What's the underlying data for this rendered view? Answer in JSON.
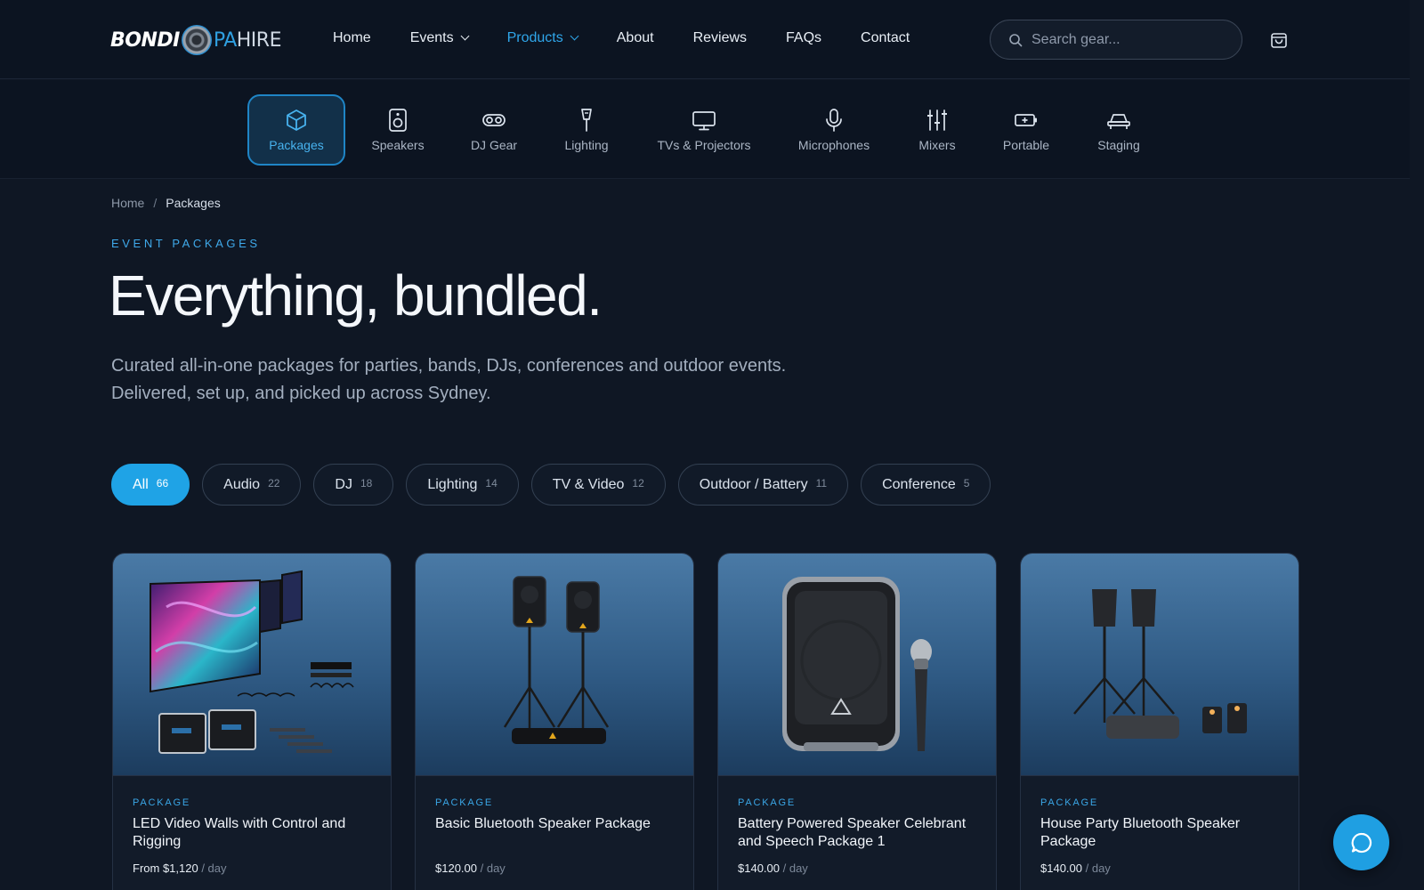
{
  "brand": {
    "name_bold": "BONDI",
    "name_light_a": "PA",
    "name_light_b": "HIRE"
  },
  "nav": {
    "items": [
      {
        "label": "Home",
        "dropdown": false,
        "active": false,
        "icon": ""
      },
      {
        "label": "Events",
        "dropdown": true,
        "active": false,
        "icon": "chevron-down-icon"
      },
      {
        "label": "Products",
        "dropdown": true,
        "active": true,
        "icon": "chevron-down-icon"
      },
      {
        "label": "About",
        "dropdown": false,
        "active": false,
        "icon": ""
      },
      {
        "label": "Reviews",
        "dropdown": false,
        "active": false,
        "icon": ""
      },
      {
        "label": "FAQs",
        "dropdown": false,
        "active": false,
        "icon": ""
      },
      {
        "label": "Contact",
        "dropdown": false,
        "active": false,
        "icon": ""
      }
    ],
    "active_color": "#2fa6ea"
  },
  "search": {
    "placeholder": "Search gear...",
    "value": "",
    "icon": "search-icon"
  },
  "cart": {
    "icon": "shopping-bag-icon"
  },
  "categories": [
    {
      "label": "Packages",
      "icon": "package-box-icon",
      "active": true
    },
    {
      "label": "Speakers",
      "icon": "speaker-icon",
      "active": false
    },
    {
      "label": "DJ Gear",
      "icon": "dj-turntable-icon",
      "active": false
    },
    {
      "label": "Lighting",
      "icon": "light-fixture-icon",
      "active": false
    },
    {
      "label": "TVs & Projectors",
      "icon": "monitor-icon",
      "active": false
    },
    {
      "label": "Microphones",
      "icon": "microphone-icon",
      "active": false
    },
    {
      "label": "Mixers",
      "icon": "mixer-sliders-icon",
      "active": false
    },
    {
      "label": "Portable",
      "icon": "battery-icon",
      "active": false
    },
    {
      "label": "Staging",
      "icon": "stage-platform-icon",
      "active": false
    }
  ],
  "breadcrumb": {
    "home": "Home",
    "separator": "/",
    "current": "Packages"
  },
  "hero": {
    "eyebrow": "EVENT PACKAGES",
    "title": "Everything, bundled.",
    "subtitle": "Curated all-in-one packages for parties, bands, DJs, conferences and outdoor events. Delivered, set up, and picked up across Sydney."
  },
  "filters": [
    {
      "label": "All",
      "count": "66",
      "active": true
    },
    {
      "label": "Audio",
      "count": "22",
      "active": false
    },
    {
      "label": "DJ",
      "count": "18",
      "active": false
    },
    {
      "label": "Lighting",
      "count": "14",
      "active": false
    },
    {
      "label": "TV & Video",
      "count": "12",
      "active": false
    },
    {
      "label": "Outdoor / Battery",
      "count": "11",
      "active": false
    },
    {
      "label": "Conference",
      "count": "5",
      "active": false
    }
  ],
  "products": [
    {
      "tag": "PACKAGE",
      "title": "LED Video Walls with Control and Rigging",
      "price": "From $1,120",
      "unit": "/ day",
      "image": "led-video-wall-image"
    },
    {
      "tag": "PACKAGE",
      "title": "Basic Bluetooth Speaker Package",
      "price": "$120.00",
      "unit": "/ day",
      "image": "speakers-on-stands-image"
    },
    {
      "tag": "PACKAGE",
      "title": "Battery Powered Speaker Celebrant and Speech Package 1",
      "price": "$140.00",
      "unit": "/ day",
      "image": "battery-speaker-microphone-image"
    },
    {
      "tag": "PACKAGE",
      "title": "House Party Bluetooth Speaker Package",
      "price": "$140.00",
      "unit": "/ day",
      "image": "speakers-uplights-image"
    }
  ],
  "chat": {
    "icon": "chat-bubble-icon"
  },
  "colors": {
    "accent": "#1fa3e6",
    "background": "#0f1724",
    "header": "#0c1421"
  }
}
